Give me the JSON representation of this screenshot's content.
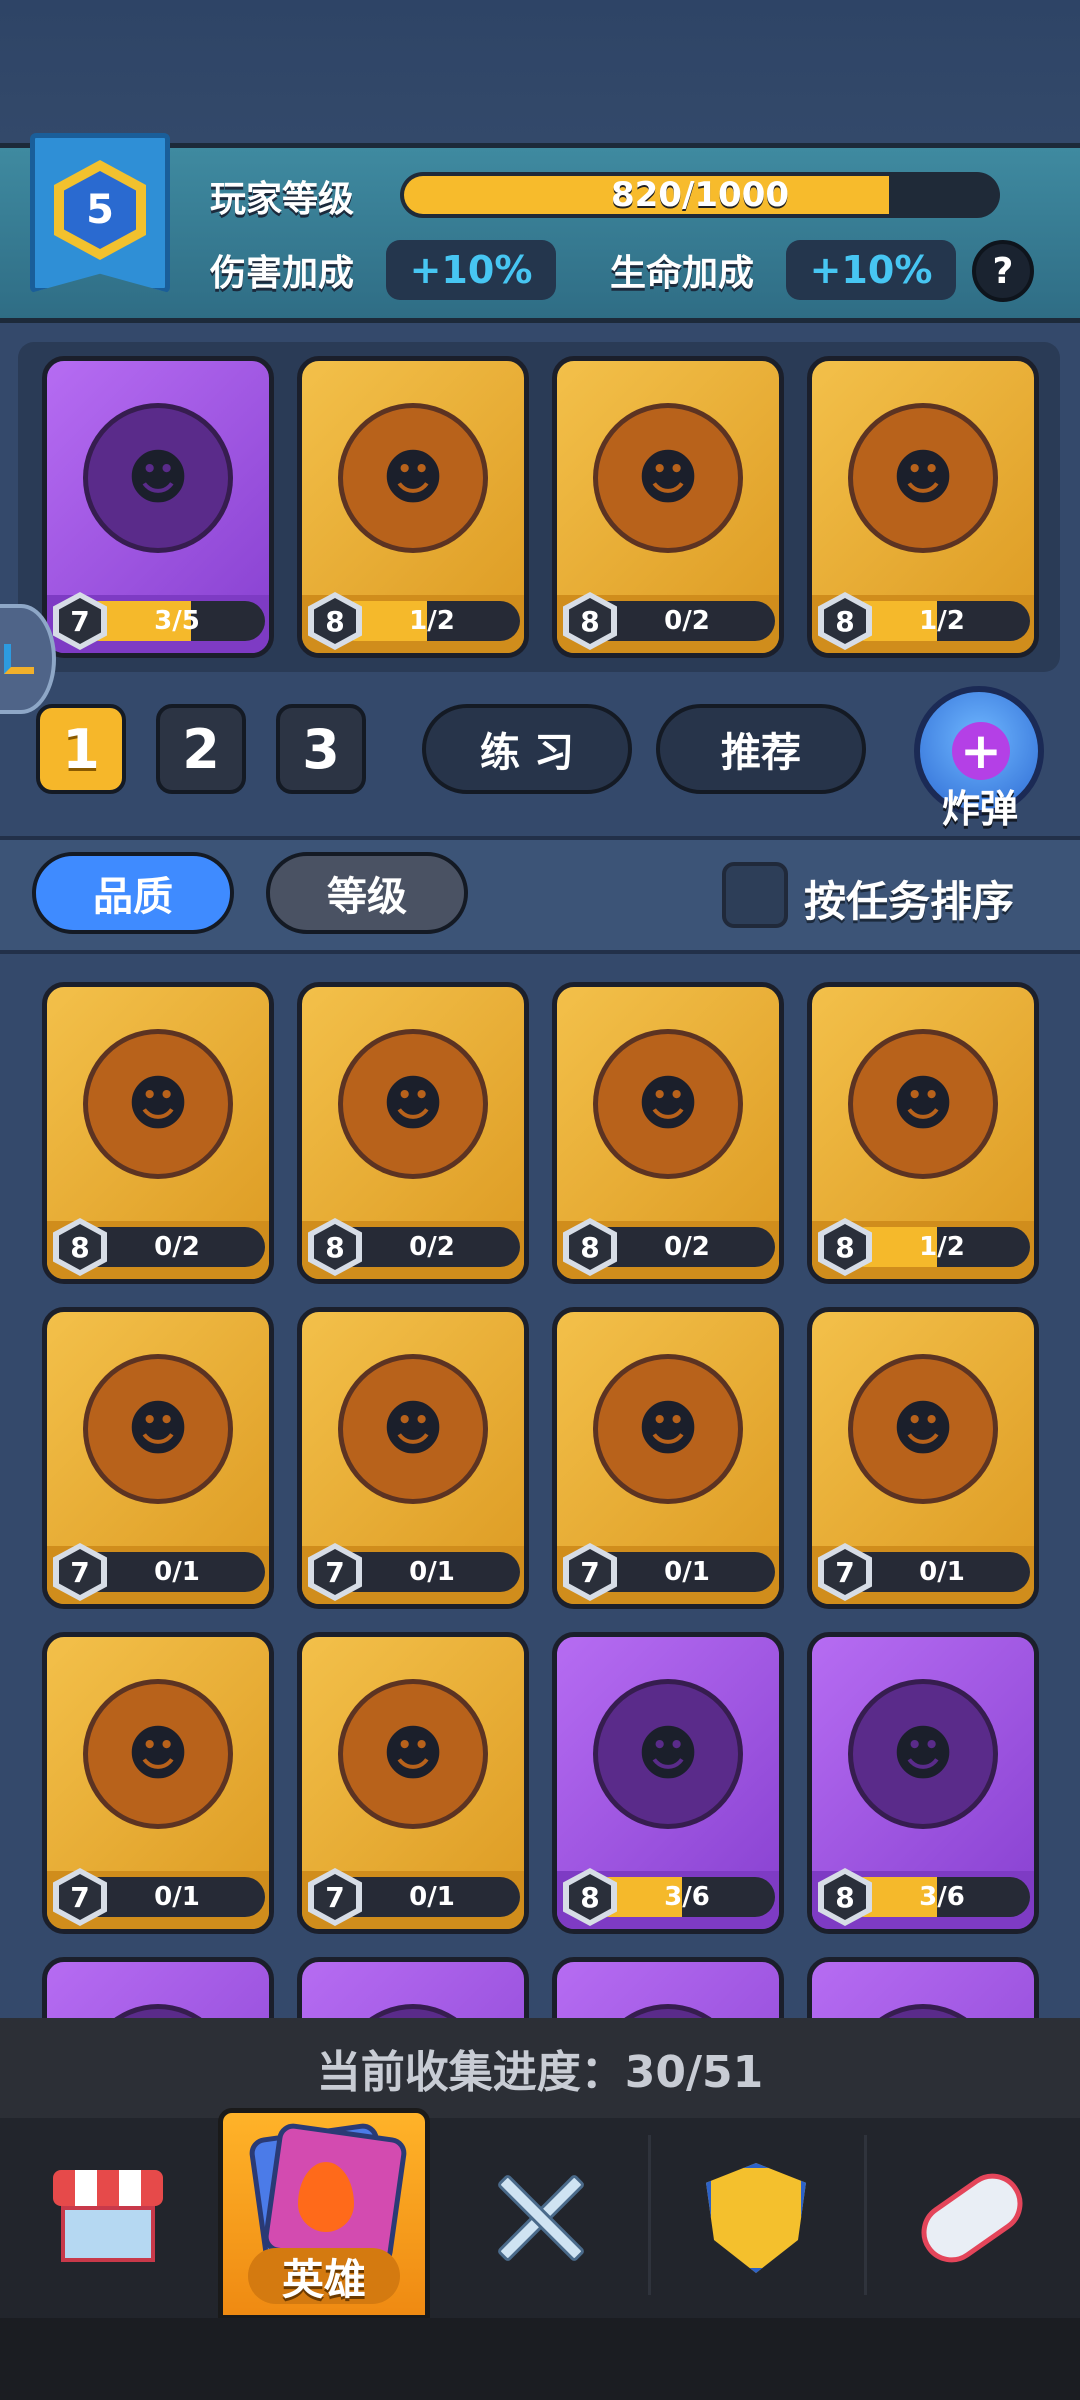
{
  "player": {
    "level": "5",
    "level_label": "玩家等级",
    "xp_text": "820/1000",
    "xp_fraction": 0.82,
    "damage_label": "伤害加成",
    "damage_value": "+10%",
    "hp_label": "生命加成",
    "hp_value": "+10%",
    "help": "?"
  },
  "team": [
    {
      "level": "7",
      "progress": "3/5",
      "fill": 0.6,
      "rarity": "purple",
      "icon": "ogre-hook-icon"
    },
    {
      "level": "8",
      "progress": "1/2",
      "fill": 0.5,
      "rarity": "gold",
      "icon": "dragon-icon"
    },
    {
      "level": "8",
      "progress": "0/2",
      "fill": 0,
      "rarity": "gold",
      "icon": "bat-monster-icon"
    },
    {
      "level": "8",
      "progress": "1/2",
      "fill": 0.5,
      "rarity": "gold",
      "icon": "fox-mask-girl-icon"
    }
  ],
  "team_slots": [
    "1",
    "2",
    "3"
  ],
  "buttons": {
    "practice": "练 习",
    "recommend": "推荐",
    "bomb": "炸弹"
  },
  "sort": {
    "quality": "品质",
    "level": "等级",
    "by_task": "按任务排序"
  },
  "heroes": [
    {
      "level": "8",
      "progress": "0/2",
      "fill": 0,
      "rarity": "gold",
      "icon": "old-dwarf-icon"
    },
    {
      "level": "8",
      "progress": "0/2",
      "fill": 0,
      "rarity": "gold",
      "icon": "spider-icon"
    },
    {
      "level": "8",
      "progress": "0/2",
      "fill": 0,
      "rarity": "gold",
      "icon": "cat-mage-icon"
    },
    {
      "level": "8",
      "progress": "1/2",
      "fill": 0.5,
      "rarity": "gold",
      "icon": "shadow-beast-icon"
    },
    {
      "level": "7",
      "progress": "0/1",
      "fill": 0,
      "rarity": "gold",
      "icon": "tribal-girl-icon"
    },
    {
      "level": "7",
      "progress": "0/1",
      "fill": 0,
      "rarity": "gold",
      "icon": "cloud-icon"
    },
    {
      "level": "7",
      "progress": "0/1",
      "fill": 0,
      "rarity": "gold",
      "icon": "vampire-girl-icon"
    },
    {
      "level": "7",
      "progress": "0/1",
      "fill": 0,
      "rarity": "gold",
      "icon": "masked-warrior-icon"
    },
    {
      "level": "7",
      "progress": "0/1",
      "fill": 0,
      "rarity": "gold",
      "icon": "knight-icon"
    },
    {
      "level": "7",
      "progress": "0/1",
      "fill": 0,
      "rarity": "gold",
      "icon": "rooster-boxer-icon"
    },
    {
      "level": "8",
      "progress": "3/6",
      "fill": 0.5,
      "rarity": "purple",
      "icon": "flower-dryad-icon"
    },
    {
      "level": "8",
      "progress": "3/6",
      "fill": 0.5,
      "rarity": "purple",
      "icon": "water-slime-icon"
    },
    {
      "level": "",
      "progress": "",
      "fill": 0,
      "rarity": "purple",
      "icon": "hero-icon"
    },
    {
      "level": "",
      "progress": "",
      "fill": 0,
      "rarity": "purple",
      "icon": "hero-icon"
    },
    {
      "level": "",
      "progress": "",
      "fill": 0,
      "rarity": "purple",
      "icon": "hero-icon"
    },
    {
      "level": "",
      "progress": "",
      "fill": 0,
      "rarity": "purple",
      "icon": "hero-icon"
    }
  ],
  "collection": "当前收集进度：30/51",
  "nav": {
    "active_label": "英雄",
    "items": [
      "shop-icon",
      "hero-cards-icon",
      "crossed-swords-icon",
      "guild-shield-icon",
      "rocket-icon"
    ]
  }
}
